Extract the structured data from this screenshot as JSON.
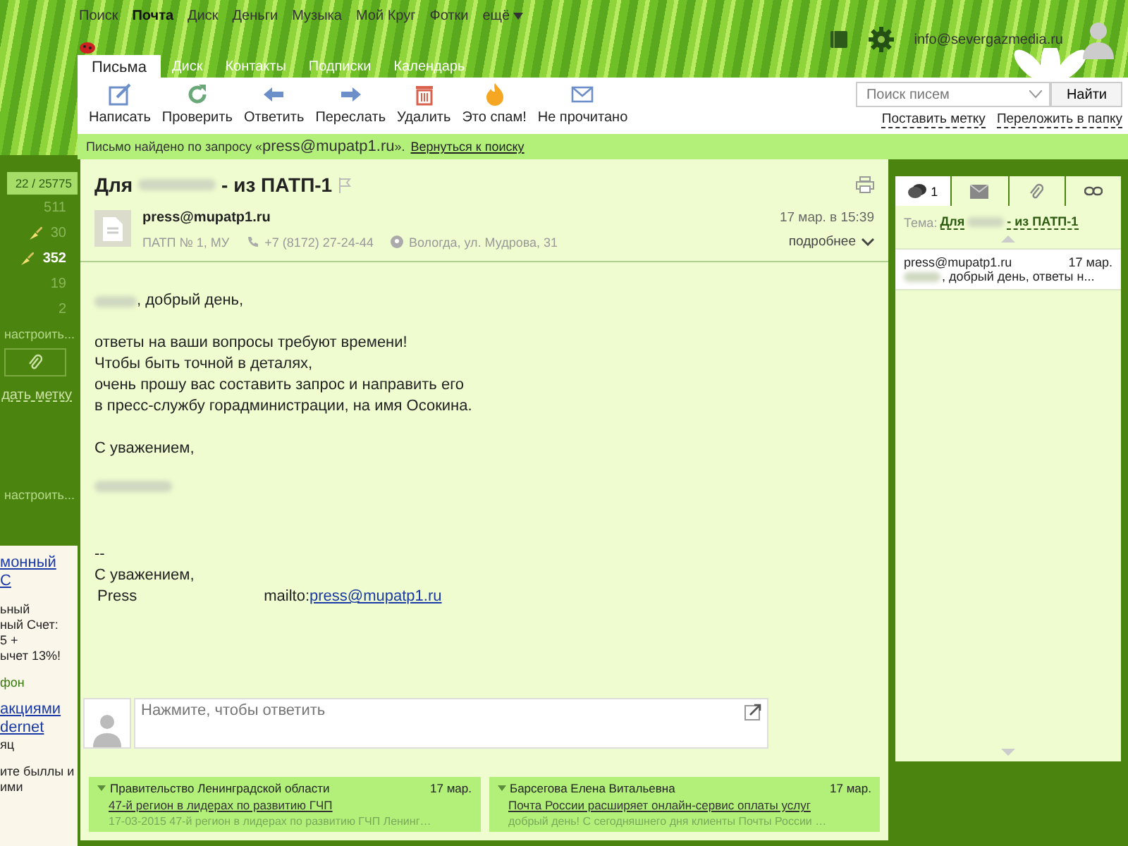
{
  "top_nav": [
    {
      "label": "Поиск",
      "selected": false
    },
    {
      "label": "Почта",
      "selected": true
    },
    {
      "label": "Диск",
      "selected": false
    },
    {
      "label": "Деньги",
      "selected": false
    },
    {
      "label": "Музыка",
      "selected": false
    },
    {
      "label": "Мой Круг",
      "selected": false
    },
    {
      "label": "Фотки",
      "selected": false
    },
    {
      "label": "ещё",
      "selected": false,
      "caret": true
    }
  ],
  "account": {
    "email": "info@severgazmedia.ru"
  },
  "tabs": [
    {
      "label": "Письма",
      "selected": true
    },
    {
      "label": "Диск",
      "selected": false
    },
    {
      "label": "Контакты",
      "selected": false
    },
    {
      "label": "Подписки",
      "selected": false
    },
    {
      "label": "Календарь",
      "selected": false
    }
  ],
  "toolbar": [
    {
      "kind": "compose",
      "label": "Написать"
    },
    {
      "kind": "refresh",
      "label": "Проверить"
    },
    {
      "kind": "reply",
      "label": "Ответить"
    },
    {
      "kind": "forward",
      "label": "Переслать"
    },
    {
      "kind": "delete",
      "label": "Удалить"
    },
    {
      "kind": "spam",
      "label": "Это спам!"
    },
    {
      "kind": "unread",
      "label": "Не прочитано"
    }
  ],
  "search": {
    "placeholder": "Поиск писем",
    "button": "Найти"
  },
  "actions": [
    "Поставить метку",
    "Переложить в папку"
  ],
  "notice": {
    "prefix": "Письмо найдено по запросу «",
    "query": "press@mupatp1.ru",
    "suffix": "».",
    "link": "Вернуться к поиску"
  },
  "sidebar": {
    "counter": "22 / 25775",
    "folders": [
      {
        "count": "511",
        "unread": false,
        "broom": false
      },
      {
        "count": "30",
        "unread": false,
        "broom": true
      },
      {
        "count": "352",
        "unread": true,
        "broom": true
      },
      {
        "count": "19",
        "unread": false,
        "broom": false
      },
      {
        "count": "2",
        "unread": false,
        "broom": false
      }
    ],
    "setup_1": "настроить...",
    "label_link": "дать метку",
    "setup_2": "настроить...",
    "ads": [
      {
        "kind": "link",
        "text": "монный"
      },
      {
        "kind": "link",
        "text": "С"
      },
      {
        "kind": "gap"
      },
      {
        "kind": "text",
        "text": "ьный"
      },
      {
        "kind": "text",
        "text": "ный Счет:"
      },
      {
        "kind": "text",
        "text": "5 +"
      },
      {
        "kind": "text",
        "text": "ычет 13%!"
      },
      {
        "kind": "gap"
      },
      {
        "kind": "green",
        "text": "фон"
      },
      {
        "kind": "gap"
      },
      {
        "kind": "link",
        "text": "акциями"
      },
      {
        "kind": "link",
        "text": "dernet"
      },
      {
        "kind": "text",
        "text": "яц"
      },
      {
        "kind": "gap"
      },
      {
        "kind": "text",
        "text": "ите быллы и"
      },
      {
        "kind": "text",
        "text": "ими"
      }
    ]
  },
  "message": {
    "subject_prefix": "Для",
    "subject_suffix": "- из ПАТП-1",
    "sender": "press@mupatp1.ru",
    "org": "ПАТП № 1, МУ",
    "phone": "+7 (8172) 27-24-44",
    "address": "Вологда, ул. Мудрова, 31",
    "date": "17 мар. в 15:39",
    "more": "подробнее",
    "body": [
      {
        "kind": "greeting",
        "text": ", добрый день,"
      },
      {
        "kind": "lines",
        "lines": [
          "ответы на ваши вопросы требуют времени!",
          "Чтобы быть точной в деталях,",
          "очень прошу вас составить запрос и направить его",
          "в пресс-службу горадминистрации, на имя Осокина."
        ]
      },
      {
        "kind": "lines",
        "lines": [
          "С уважением,"
        ]
      },
      {
        "kind": "redacted"
      },
      {
        "kind": "lines",
        "lines": [
          "--",
          "С уважением,"
        ]
      },
      {
        "kind": "contact",
        "name": "Press",
        "prefix": "mailto:",
        "link": "press@mupatp1.ru"
      }
    ]
  },
  "reply": {
    "placeholder": "Нажмите, чтобы ответить"
  },
  "related": [
    {
      "sender": "Правительство Ленинградской области",
      "date": "17 мар.",
      "subject": "47-й регион в лидерах по развитию ГЧП",
      "snippet": "17-03-2015 47-й регион в лидерах по развитию ГЧП Ленинг…"
    },
    {
      "sender": "Барсегова Елена Витальевна",
      "date": "17 мар.",
      "subject": "Почта России расширяет онлайн-сервис оплаты услуг",
      "snippet": "добрый день! С сегодняшнего дня клиенты Почты России …"
    }
  ],
  "thread_panel": {
    "tabs": [
      {
        "kind": "thread",
        "count": "1",
        "selected": true
      },
      {
        "kind": "mail",
        "selected": false
      },
      {
        "kind": "attachment",
        "selected": false
      },
      {
        "kind": "link",
        "selected": false
      }
    ],
    "topic_label": "Тема:",
    "topic_prefix": "Для",
    "topic_suffix": "- из ПАТП-1",
    "items": [
      {
        "sender": "press@mupatp1.ru",
        "date": "17 мар.",
        "snippet": ", добрый день, ответы н...",
        "selected": true
      }
    ]
  }
}
